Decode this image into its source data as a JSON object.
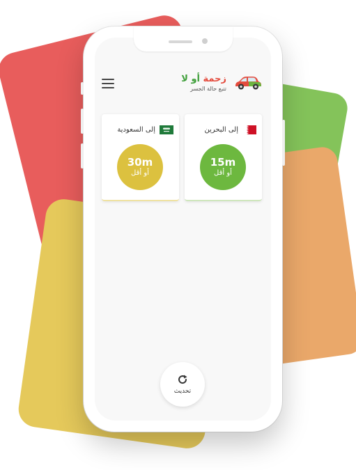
{
  "app": {
    "title_part1": "زحمة",
    "title_part2": "أو لا",
    "subtitle": "تتبع حالة الجسر",
    "logo_icon": "car-icon"
  },
  "header": {
    "menu_icon": "hamburger-menu-icon"
  },
  "cards": [
    {
      "id": "saudi",
      "title": "إلى السعودية",
      "flag_icon": "saudi-flag-icon",
      "time": "30m",
      "note": "أو أقل",
      "status_color": "#dcc13f"
    },
    {
      "id": "bahrain",
      "title": "إلى البحرين",
      "flag_icon": "bahrain-flag-icon",
      "time": "15m",
      "note": "أو أقل",
      "status_color": "#6db83f"
    }
  ],
  "refresh": {
    "label": "تحديث",
    "icon": "refresh-icon"
  },
  "colors": {
    "red": "#e85d5c",
    "green": "#84c35a",
    "orange": "#eaa86a",
    "yellow": "#e5c95b"
  }
}
